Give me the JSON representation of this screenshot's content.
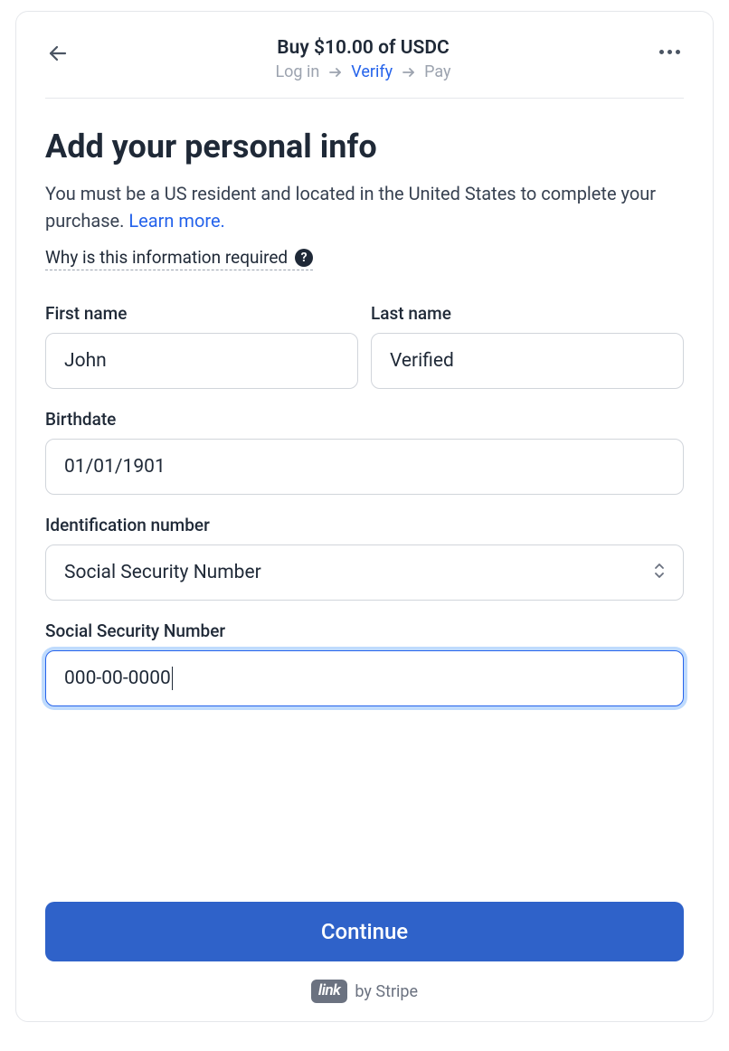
{
  "header": {
    "title": "Buy $10.00 of USDC",
    "breadcrumb": {
      "login": "Log in",
      "verify": "Verify",
      "pay": "Pay"
    }
  },
  "page": {
    "title": "Add your personal info",
    "description": "You must be a US resident and located in the United States to complete your purchase. ",
    "learn_more": "Learn more.",
    "why_required": "Why is this information required"
  },
  "form": {
    "first_name": {
      "label": "First name",
      "value": "John"
    },
    "last_name": {
      "label": "Last name",
      "value": "Verified"
    },
    "birthdate": {
      "label": "Birthdate",
      "value": "01/01/1901"
    },
    "id_number": {
      "label": "Identification number",
      "selected": "Social Security Number"
    },
    "ssn": {
      "label": "Social Security Number",
      "value": "000-00-0000"
    }
  },
  "actions": {
    "continue": "Continue"
  },
  "footer": {
    "link_badge": "link",
    "by_stripe": "by Stripe"
  }
}
